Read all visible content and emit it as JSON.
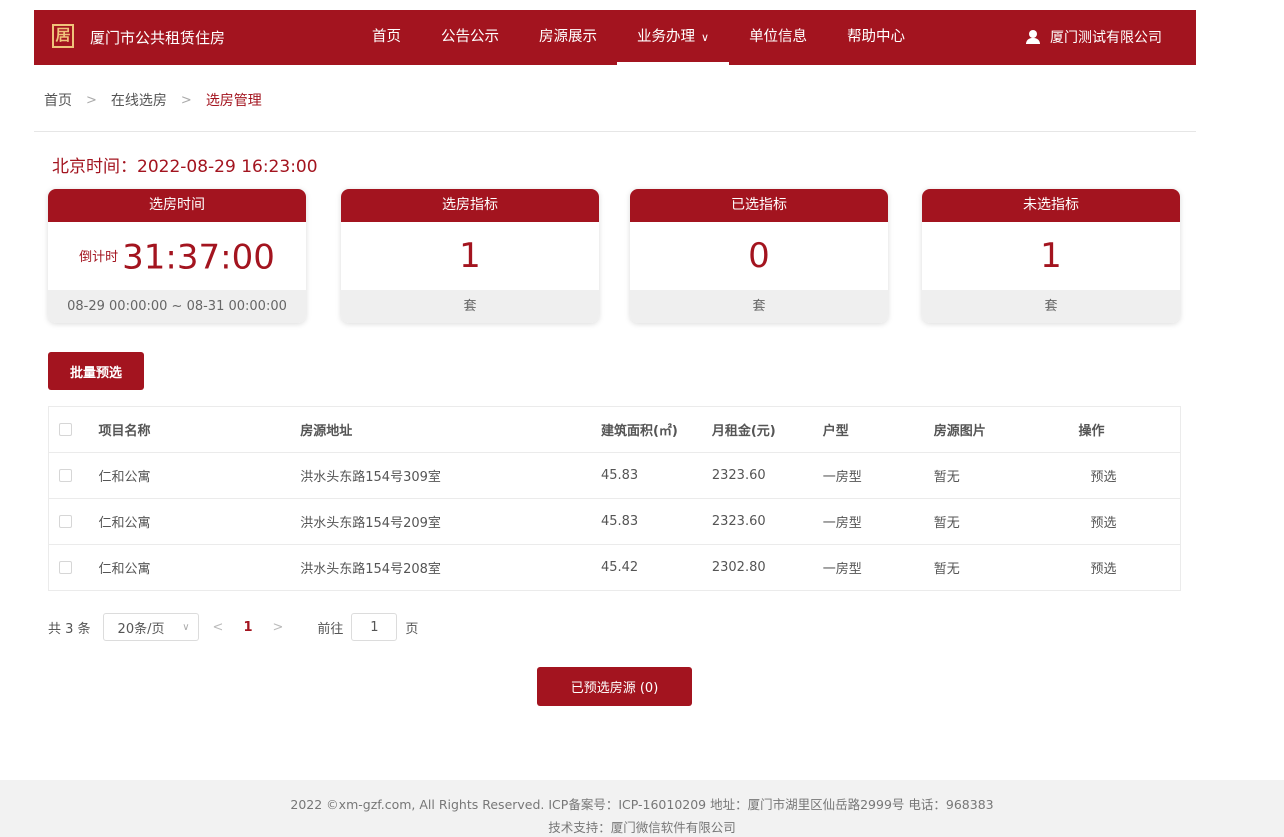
{
  "header": {
    "logo_glyph": "居",
    "site_title": "厦门市公共租赁住房",
    "nav": [
      {
        "label": "首页"
      },
      {
        "label": "公告公示"
      },
      {
        "label": "房源展示"
      },
      {
        "label": "业务办理",
        "has_dropdown": true,
        "active": true
      },
      {
        "label": "单位信息"
      },
      {
        "label": "帮助中心"
      }
    ],
    "user_name": "厦门测试有限公司"
  },
  "breadcrumb": {
    "items": [
      "首页",
      "在线选房",
      "选房管理"
    ]
  },
  "beijing_time": "北京时间：2022-08-29 16:23:00",
  "cards": [
    {
      "title": "选房时间",
      "countdown_label": "倒计时",
      "countdown": "31:37:00",
      "footer": "08-29 00:00:00 ~ 08-31 00:00:00"
    },
    {
      "title": "选房指标",
      "value": "1",
      "footer": "套"
    },
    {
      "title": "已选指标",
      "value": "0",
      "footer": "套"
    },
    {
      "title": "未选指标",
      "value": "1",
      "footer": "套"
    }
  ],
  "batch_button": "批量预选",
  "table": {
    "headers": [
      "项目名称",
      "房源地址",
      "建筑面积(㎡)",
      "月租金(元)",
      "户型",
      "房源图片",
      "操作"
    ],
    "rows": [
      {
        "project": "仁和公寓",
        "address": "洪水头东路154号309室",
        "area": "45.83",
        "rent": "2323.60",
        "type": "一房型",
        "image": "暂无",
        "action": "预选"
      },
      {
        "project": "仁和公寓",
        "address": "洪水头东路154号209室",
        "area": "45.83",
        "rent": "2323.60",
        "type": "一房型",
        "image": "暂无",
        "action": "预选"
      },
      {
        "project": "仁和公寓",
        "address": "洪水头东路154号208室",
        "area": "45.42",
        "rent": "2302.80",
        "type": "一房型",
        "image": "暂无",
        "action": "预选"
      }
    ]
  },
  "pagination": {
    "total": "共 3 条",
    "page_size": "20条/页",
    "current_page": "1",
    "goto_label": "前往",
    "goto_value": "1",
    "page_unit": "页"
  },
  "preselected_button": "已预选房源 (0)",
  "footer": {
    "line1": "2022 ©xm-gzf.com, All Rights Reserved. ICP备案号：ICP-16010209 地址：厦门市湖里区仙岳路2999号 电话：968383",
    "line2": "技术支持：厦门微信软件有限公司"
  },
  "colors": {
    "brand": "#a3141f",
    "footer_bg": "#f2f2f2"
  },
  "icons": [
    "logo-icon",
    "chevron-down-icon",
    "user-icon",
    "chevron-right-icon",
    "chevron-left-icon",
    "checkbox-icon"
  ]
}
